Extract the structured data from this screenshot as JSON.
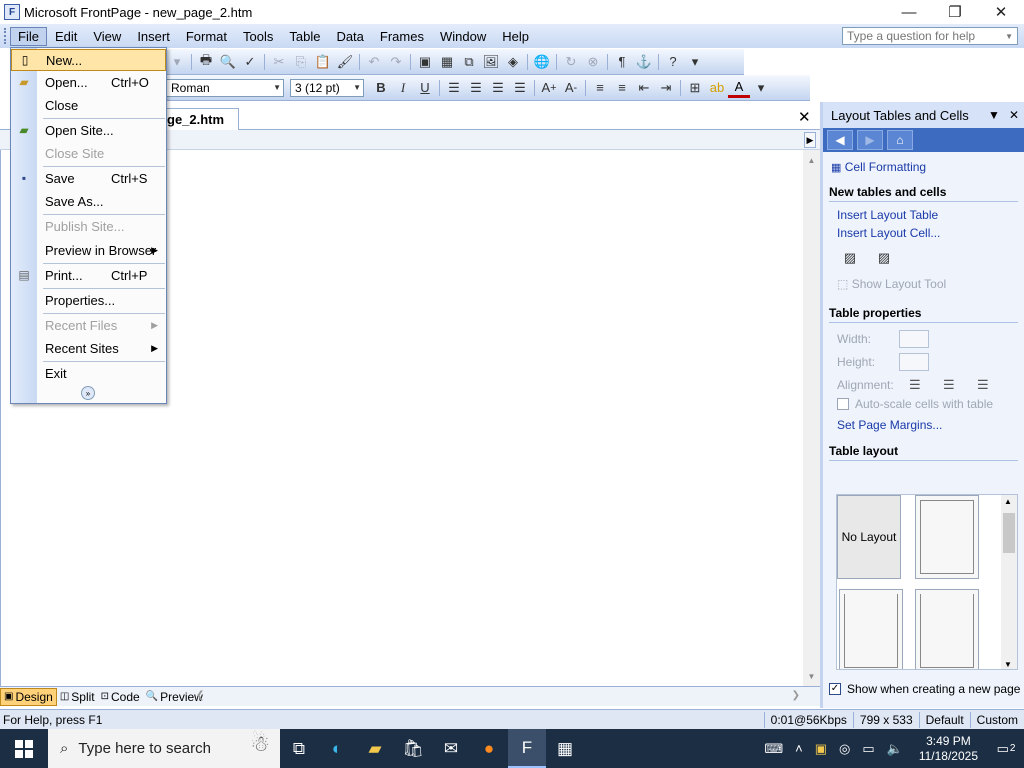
{
  "window": {
    "title": "Microsoft FrontPage - new_page_2.htm",
    "minimize": "—",
    "restore": "❐",
    "close": "✕"
  },
  "menubar": {
    "items": [
      "File",
      "Edit",
      "View",
      "Insert",
      "Format",
      "Tools",
      "Table",
      "Data",
      "Frames",
      "Window",
      "Help"
    ],
    "active": "File"
  },
  "help_box": {
    "placeholder": "Type a question for help"
  },
  "toolbar_format": {
    "font": "Roman",
    "size": "3 (12 pt)"
  },
  "document": {
    "tab_label": "ge_2.htm",
    "close": "✕"
  },
  "file_menu": {
    "items": [
      {
        "label": "New...",
        "shortcut": "",
        "enabled": true,
        "highlighted": true,
        "icon": "new-page-icon",
        "submenu": false
      },
      {
        "label": "Open...",
        "shortcut": "Ctrl+O",
        "enabled": true,
        "icon": "open-folder-icon",
        "submenu": false
      },
      {
        "label": "Close",
        "shortcut": "",
        "enabled": true,
        "submenu": false
      },
      {
        "label": "Open Site...",
        "shortcut": "",
        "enabled": true,
        "icon": "open-site-icon",
        "submenu": false
      },
      {
        "label": "Close Site",
        "shortcut": "",
        "enabled": false,
        "submenu": false
      },
      {
        "label": "Save",
        "shortcut": "Ctrl+S",
        "enabled": true,
        "icon": "save-icon",
        "submenu": false
      },
      {
        "label": "Save As...",
        "shortcut": "",
        "enabled": true,
        "submenu": false
      },
      {
        "label": "Publish Site...",
        "shortcut": "",
        "enabled": false,
        "submenu": false
      },
      {
        "label": "Preview in Browser",
        "shortcut": "",
        "enabled": true,
        "submenu": true
      },
      {
        "label": "Print...",
        "shortcut": "Ctrl+P",
        "enabled": true,
        "icon": "print-icon",
        "submenu": false
      },
      {
        "label": "Properties...",
        "shortcut": "",
        "enabled": true,
        "submenu": false
      },
      {
        "label": "Recent Files",
        "shortcut": "",
        "enabled": false,
        "submenu": true
      },
      {
        "label": "Recent Sites",
        "shortcut": "",
        "enabled": true,
        "submenu": true
      },
      {
        "label": "Exit",
        "shortcut": "",
        "enabled": true,
        "submenu": false
      }
    ]
  },
  "view_tabs": [
    "Design",
    "Split",
    "Code",
    "Preview"
  ],
  "task_pane": {
    "title": "Layout Tables and Cells",
    "cell_formatting": "Cell Formatting",
    "new_tables_heading": "New tables and cells",
    "insert_layout_table": "Insert Layout Table",
    "insert_layout_cell": "Insert Layout Cell...",
    "show_layout_tool": "Show Layout Tool",
    "table_properties_heading": "Table properties",
    "width_label": "Width:",
    "height_label": "Height:",
    "alignment_label": "Alignment:",
    "autoscale_label": "Auto-scale cells with table",
    "set_margins": "Set Page Margins...",
    "table_layout_heading": "Table layout",
    "no_layout": "No Layout",
    "show_when_creating": "Show when creating a new page"
  },
  "statusbar": {
    "help": "For Help, press F1",
    "speed": "0:01@56Kbps",
    "size": "799 x 533",
    "mode1": "Default",
    "mode2": "Custom"
  },
  "taskbar": {
    "search_placeholder": "Type here to search",
    "time": "3:49 PM",
    "date": "11/18/2025",
    "notification_count": "2"
  }
}
